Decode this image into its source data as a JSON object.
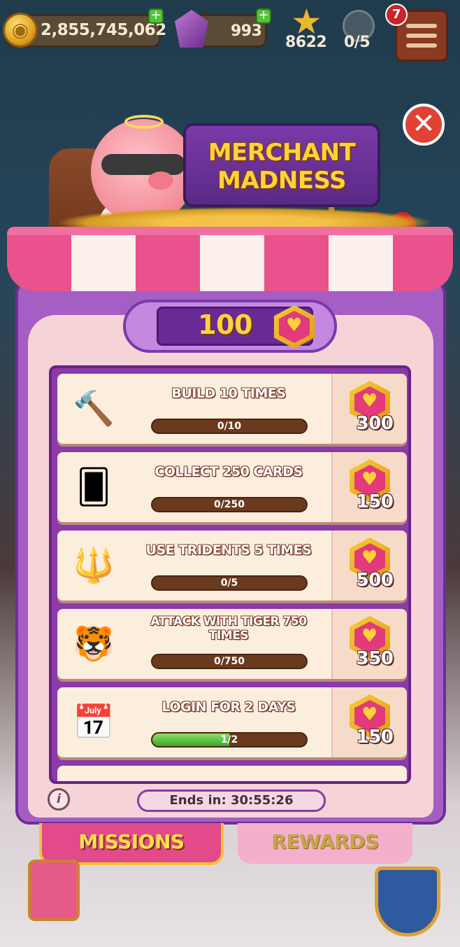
{
  "hud": {
    "coins": "2,855,745,062",
    "gems": "993",
    "stars": "8622",
    "shields": "0/5",
    "notifications": "7"
  },
  "popup": {
    "title_line1": "MERCHANT",
    "title_line2": "MADNESS",
    "token_balance": "100",
    "timer": "Ends in: 30:55:26"
  },
  "missions": [
    {
      "icon": "hammer-icon",
      "glyph": "🔨",
      "title": "BUILD 10 TIMES",
      "progress": "0/10",
      "fraction": 0,
      "reward": "300"
    },
    {
      "icon": "cards-icon",
      "glyph": "🂠",
      "title": "COLLECT 250 CARDS",
      "progress": "0/250",
      "fraction": 0,
      "reward": "150"
    },
    {
      "icon": "trident-icon",
      "glyph": "🔱",
      "title": "USE TRIDENTS 5 TIMES",
      "progress": "0/5",
      "fraction": 0,
      "reward": "500"
    },
    {
      "icon": "tiger-icon",
      "glyph": "🐯",
      "title": "ATTACK WITH TIGER 750 TIMES",
      "progress": "0/750",
      "fraction": 0,
      "reward": "350"
    },
    {
      "icon": "calendar-icon",
      "glyph": "📅",
      "title": "LOGIN FOR 2 DAYS",
      "progress": "1/2",
      "fraction": 0.5,
      "reward": "150"
    }
  ],
  "tabs": {
    "missions": "MISSIONS",
    "rewards": "REWARDS"
  },
  "colors": {
    "accent": "#e24a8a",
    "panel": "#a45ec4",
    "gold": "#ffd23a"
  }
}
